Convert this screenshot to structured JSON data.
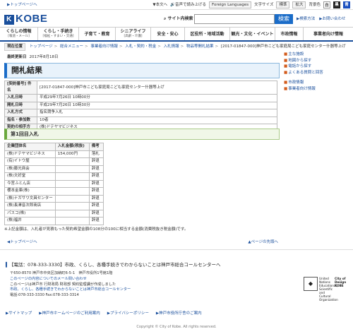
{
  "topbar": {
    "home": "トップページへ",
    "tools": [
      {
        "label": "本文へ",
        "icon": "arrow-down-icon"
      },
      {
        "label": "音声で読み上げる",
        "icon": "speaker-icon"
      },
      {
        "label": "Foreign Languages",
        "icon": "globe-icon"
      },
      {
        "label": "文字サイズ"
      },
      {
        "label": "標準"
      },
      {
        "label": "拡大"
      },
      {
        "label": "背景色"
      }
    ],
    "color_boxes": [
      {
        "label": "白",
        "bg": "#ffffff",
        "fg": "#333333"
      },
      {
        "label": "黒",
        "bg": "#222222",
        "fg": "#ffffff"
      },
      {
        "label": "青",
        "bg": "#1a4fbf",
        "fg": "#ffffff"
      }
    ]
  },
  "logo": {
    "text": "KOBE"
  },
  "search": {
    "label": "サイト内検索",
    "button": "検索"
  },
  "header_links": [
    "検索方法",
    "お問い合わせ"
  ],
  "nav": [
    {
      "label": "くらしの情報",
      "sub": "[報道・メール]"
    },
    {
      "label": "くらし・手続き",
      "sub": "[福祉・すまい・交通]"
    },
    {
      "label": "子育て・教育",
      "sub": ""
    },
    {
      "label": "シニアライフ",
      "sub": "[高齢・介護]"
    },
    {
      "label": "安全・安心",
      "sub": ""
    },
    {
      "label": "区役所・地域活動",
      "sub": ""
    },
    {
      "label": "観光・文化・イベント",
      "sub": ""
    },
    {
      "label": "市政情報",
      "sub": ""
    },
    {
      "label": "事業者向け情報",
      "sub": ""
    }
  ],
  "breadcrumb": {
    "here": "現在位置",
    "items": [
      "トップページ",
      "総合メニュー",
      "事業者向け情報",
      "入札・契約・税金",
      "入札情報",
      "物品等開札結果",
      "[2017-01847-000]神戸市こども家庭局こども家庭センター什器等上げ"
    ]
  },
  "updated": {
    "label": "最終更新日",
    "date": "2017年8月18日"
  },
  "title": "開札結果",
  "info_rows": [
    [
      "[契約番号] 件名",
      "[2017-01847-000]神戸市こども家庭局こども家庭センター什器等上げ"
    ],
    [
      "入札日時",
      "平成29年7月26日 10時00分"
    ],
    [
      "開札日時",
      "平成29年7月26日 10時30分"
    ],
    [
      "入札方式",
      "指名競争入札"
    ],
    [
      "指名・参加数",
      "10者"
    ],
    [
      "契約の相手方",
      "(株)ドテヤマビジネス"
    ]
  ],
  "round_title": "第1回目入札",
  "bid_header": [
    "企業団体名",
    "入札金額(税抜)",
    "備考"
  ],
  "bids": [
    [
      "(株)ドテヤマビジネス",
      "154,000円",
      "落札"
    ],
    [
      "(有)イトウ屋",
      "",
      "辞退"
    ],
    [
      "(株)藤光商会",
      "",
      "辞退"
    ],
    [
      "(株)文好堂",
      "",
      "辞退"
    ],
    [
      "今宮ふとん店",
      "",
      "辞退"
    ],
    [
      "櫻本金庫(株)",
      "",
      "辞退"
    ],
    [
      "(株)ナガサワ文具センター",
      "",
      "辞退"
    ],
    [
      "(株)長澤音次郎商店",
      "",
      "辞退"
    ],
    [
      "パスコ(株)",
      "",
      "辞退"
    ],
    [
      "(株)福井",
      "",
      "辞退"
    ]
  ],
  "note": "※上記金額は、入札者が見積もった契約希望金額の108分の100に相当する金額(消費税抜き税金額)です。",
  "pagenav": {
    "top": "トップページへ",
    "pagetop": "ページの先頭へ"
  },
  "side": {
    "group1": [
      "主な施設",
      "地図から探す",
      "電話から探す",
      "よくある質問と回答"
    ],
    "group2": [
      "市政情報",
      "事業者向け情報"
    ]
  },
  "footer": {
    "contact": "【電話：078-333-3330】市政、くらし、各種手続きでわからないことは神戸市総合コールセンターへ",
    "address_lines": [
      "〒650-8570 神戸市中央区加納町6-5-1　神戸市役所1号館1階",
      "このページの内容についてのメール問い合わせ",
      "このページは神戸市 行財政局 財政部 契約監理課が作成しました",
      "市政、くらし、各種手続きでわからないことは神戸市総合コールセンター",
      "電話:078-333-3330 Fax:078-333-3314"
    ],
    "links": [
      "サイトマップ",
      "神戸市ホームページのご利用案内",
      "プライバシーポリシー",
      "神戸市役所庁舎のご案内"
    ],
    "copyright": "Copyright © City of Kobe. All rights reserved.",
    "unesco": {
      "left": "United Nations Educational, Scientific and Cultural Organization",
      "right": "City of Design KOBE"
    }
  }
}
